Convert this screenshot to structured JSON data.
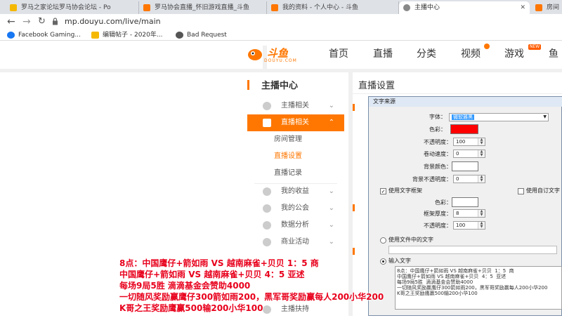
{
  "browser": {
    "tabs": [
      {
        "title": "罗马之家论坛罗马协会论坛 - Po",
        "color": "#f5b800"
      },
      {
        "title": "罗马协会直播_怀旧游戏直播_斗鱼",
        "color": "#ff7700"
      },
      {
        "title": "我的资料 - 个人中心 - 斗鱼",
        "color": "#ff7700"
      },
      {
        "title": "主播中心",
        "color": "#888888",
        "active": true
      },
      {
        "title": "房间",
        "color": "#ff7700"
      }
    ],
    "url": "mp.douyu.com/live/main",
    "bookmarks": [
      {
        "label": "Facebook Gaming...",
        "color": "#1877f2"
      },
      {
        "label": "编辑帖子 - 2020年...",
        "color": "#f5b800"
      },
      {
        "label": "Bad Request",
        "color": "#555555"
      }
    ]
  },
  "site": {
    "logo_main": "斗鱼",
    "logo_sub": "DOUYU.COM",
    "nav": [
      "首页",
      "直播",
      "分类",
      "视频",
      "游戏",
      "鱼"
    ],
    "nav_badge": "NEW"
  },
  "sidebar": {
    "title": "主播中心",
    "items": [
      {
        "label": "主播相关"
      },
      {
        "label": "直播相关",
        "active": true
      },
      {
        "label": "我的收益"
      },
      {
        "label": "我的公会"
      },
      {
        "label": "数据分析"
      },
      {
        "label": "商业活动"
      },
      {
        "label": "主播扶持"
      }
    ],
    "subitems": [
      "房间管理",
      "直播设置",
      "直播记录"
    ]
  },
  "main": {
    "title": "直播设置"
  },
  "dialog": {
    "title": "文字来源",
    "font_label": "字体：",
    "font_value": "微软雅黑",
    "color_label": "色彩：",
    "color_value": "#ff0000",
    "opacity_label": "不透明度：",
    "opacity_value": "100",
    "scroll_label": "卷动速度：",
    "scroll_value": "0",
    "bg_label": "背景颜色：",
    "bg_opacity_label": "背景不透明度：",
    "bg_opacity_value": "0",
    "use_border_label": "使用文字框架",
    "use_custom_label": "使用自订文字",
    "border_color_label": "色彩：",
    "border_thickness_label": "框架厚度：",
    "border_thickness_value": "8",
    "border_opacity_label": "不透明度：",
    "border_opacity_value": "100",
    "use_file_label": "使用文件中的文字",
    "input_text_label": "输入文字",
    "input_text": "8点：中国鹰仔+箭如雨 VS 越南麻雀+贝贝  1：5  商\n中国鹰仔+箭如雨 VS 越南麻雀+贝贝  4：5  亚述\n每场9局5胜  滴滴基金会赞助4000\n一切随风奖励赢鹰仔300箭如雨200，黑军哥奖励赢每人200小华200\nK哥之王奖励鹰赢500输200小华100"
  },
  "overlay_lines": [
    "8点：中国鹰仔+箭如雨 VS 越南麻雀+贝贝  1：5  商",
    "中国鹰仔+箭如雨 VS 越南麻雀+贝贝  4：5  亚述",
    "每场9局5胜  滴滴基金会赞助4000",
    "一切随风奖励赢鹰仔300箭如雨200，黑军哥奖励赢每人200小华200",
    "K哥之王奖励鹰赢500输200小华100"
  ]
}
